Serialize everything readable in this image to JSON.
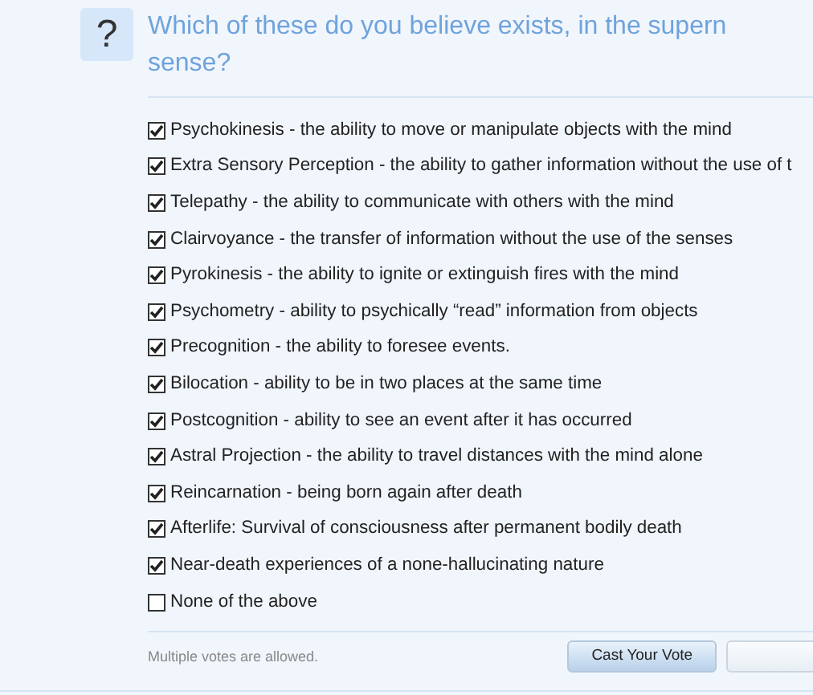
{
  "question": {
    "icon": "?",
    "title": "Which of these do you believe exists, in the supern",
    "title_line_2": "sense?"
  },
  "options": [
    {
      "label": "Psychokinesis - the ability to move or manipulate objects with the mind",
      "checked": true
    },
    {
      "label": "Extra Sensory Perception - the ability to gather information without the use of t",
      "checked": true
    },
    {
      "label": "Telepathy - the ability to communicate with others with the mind",
      "checked": true
    },
    {
      "label": "Clairvoyance - the transfer of information without the use of the senses",
      "checked": true
    },
    {
      "label": "Pyrokinesis - the ability to ignite or extinguish fires with the mind",
      "checked": true
    },
    {
      "label": "Psychometry - ability to psychically “read” information from objects",
      "checked": true
    },
    {
      "label": "Precognition - the ability to foresee events.",
      "checked": true
    },
    {
      "label": "Bilocation - ability to be in two places at the same time",
      "checked": true
    },
    {
      "label": "Postcognition - ability to see an event after it has occurred",
      "checked": true
    },
    {
      "label": "Astral Projection - the ability to travel distances with the mind alone",
      "checked": true
    },
    {
      "label": "Reincarnation - being born again after death",
      "checked": true
    },
    {
      "label": "Afterlife: Survival of consciousness after permanent bodily death",
      "checked": true
    },
    {
      "label": "Near-death experiences of a none-hallucinating nature",
      "checked": true
    },
    {
      "label": "None of the above",
      "checked": false
    }
  ],
  "footer": {
    "note": "Multiple votes are allowed.",
    "button": "Cast Your Vote"
  }
}
